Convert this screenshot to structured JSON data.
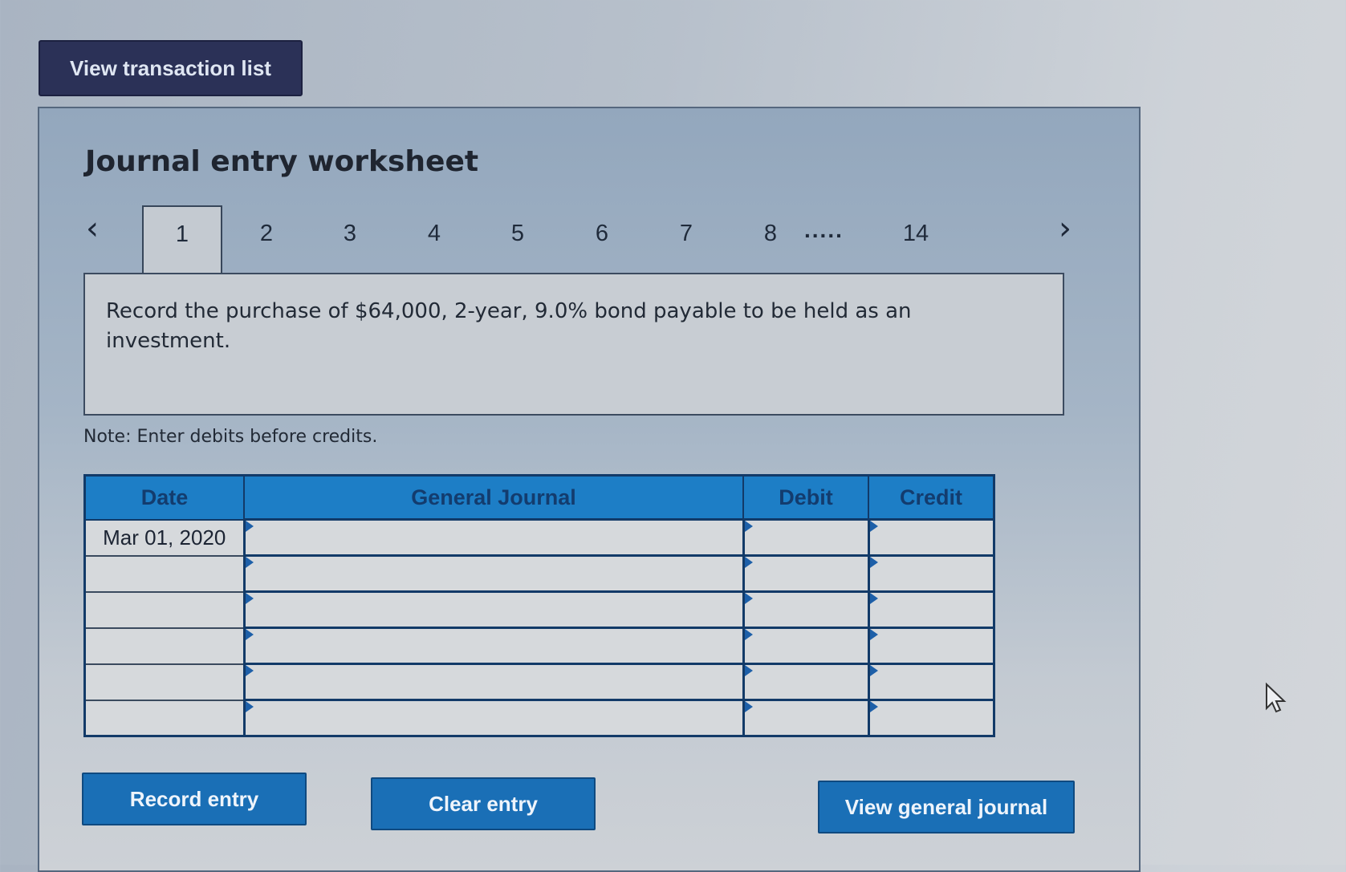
{
  "top_button": {
    "label": "View transaction list"
  },
  "worksheet": {
    "title": "Journal entry worksheet",
    "tabs": [
      "1",
      "2",
      "3",
      "4",
      "5",
      "6",
      "7",
      "8",
      "14"
    ],
    "active_tab": "1",
    "ellipsis": ".....",
    "prev_icon": "chevron-left-icon",
    "next_icon": "chevron-right-icon",
    "prompt": "Record the purchase of $64,000, 2-year, 9.0% bond payable to be held as an investment.",
    "note": "Note: Enter debits before credits."
  },
  "table": {
    "headers": [
      "Date",
      "General Journal",
      "Debit",
      "Credit"
    ],
    "rows": [
      {
        "date": "Mar 01, 2020",
        "account": "",
        "debit": "",
        "credit": ""
      },
      {
        "date": "",
        "account": "",
        "debit": "",
        "credit": ""
      },
      {
        "date": "",
        "account": "",
        "debit": "",
        "credit": ""
      },
      {
        "date": "",
        "account": "",
        "debit": "",
        "credit": ""
      },
      {
        "date": "",
        "account": "",
        "debit": "",
        "credit": ""
      },
      {
        "date": "",
        "account": "",
        "debit": "",
        "credit": ""
      }
    ]
  },
  "buttons": {
    "record": "Record entry",
    "clear": "Clear entry",
    "view_journal": "View general journal"
  },
  "colors": {
    "header_blue": "#1d7ec6",
    "button_blue": "#1a6fb6",
    "dark_navy": "#2b3157"
  }
}
